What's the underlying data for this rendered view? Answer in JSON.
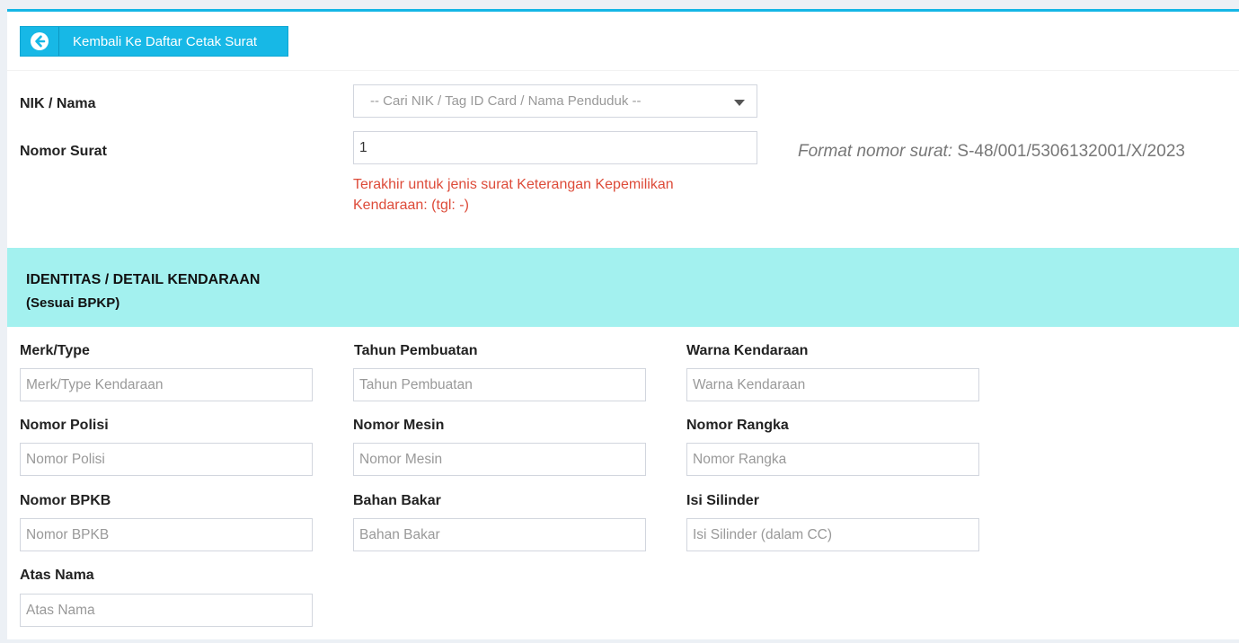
{
  "header": {
    "back_button_label": "Kembali Ke Daftar Cetak Surat"
  },
  "form": {
    "nik_label": "NIK / Nama",
    "nik_placeholder": "-- Cari NIK / Tag ID Card / Nama Penduduk --",
    "nomor_surat_label": "Nomor Surat",
    "nomor_surat_value": "1",
    "warning_text": "Terakhir untuk jenis surat Keterangan Kepemilikan Kendaraan: (tgl: -)",
    "format_prefix": "Format nomor surat:",
    "format_value": "S-48/001/5306132001/X/2023"
  },
  "section": {
    "title": "IDENTITAS / DETAIL KENDARAAN",
    "subtitle": "(Sesuai BPKP)"
  },
  "fields": {
    "merk": {
      "label": "Merk/Type",
      "placeholder": "Merk/Type Kendaraan"
    },
    "tahun": {
      "label": "Tahun Pembuatan",
      "placeholder": "Tahun Pembuatan"
    },
    "warna": {
      "label": "Warna Kendaraan",
      "placeholder": "Warna Kendaraan"
    },
    "polisi": {
      "label": "Nomor Polisi",
      "placeholder": "Nomor Polisi"
    },
    "mesin": {
      "label": "Nomor Mesin",
      "placeholder": "Nomor Mesin"
    },
    "rangka": {
      "label": "Nomor Rangka",
      "placeholder": "Nomor Rangka"
    },
    "bpkb": {
      "label": "Nomor BPKB",
      "placeholder": "Nomor BPKB"
    },
    "bahan_bakar": {
      "label": "Bahan Bakar",
      "placeholder": "Bahan Bakar"
    },
    "silinder": {
      "label": "Isi Silinder",
      "placeholder": "Isi Silinder (dalam CC)"
    },
    "atas_nama": {
      "label": "Atas Nama",
      "placeholder": "Atas Nama"
    }
  },
  "colors": {
    "accent": "#14b6e5",
    "button": "#17b8e6",
    "section_band": "#a3f1ef",
    "warning": "#dd4b39"
  },
  "icons": {
    "back": "arrow-circle-left-icon",
    "dropdown": "caret-down-icon"
  }
}
